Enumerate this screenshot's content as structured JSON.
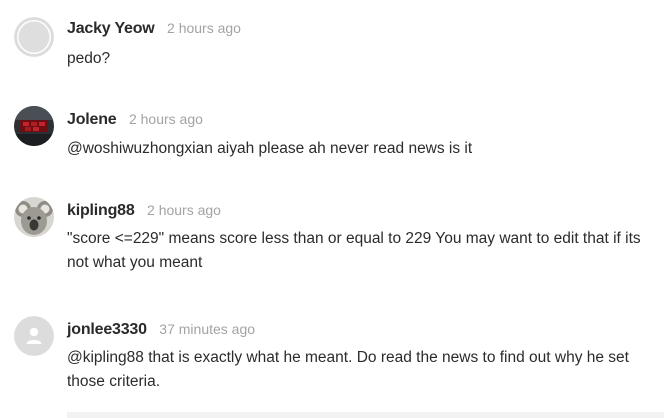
{
  "comments": [
    {
      "author": "Jacky Yeow",
      "time": "2 hours ago",
      "text": "pedo?",
      "avatar": "default-user-icon"
    },
    {
      "author": "Jolene",
      "time": "2 hours ago",
      "text": "@woshiwuzhongxian aiyah please ah never read news is it",
      "avatar": "photo-avatar"
    },
    {
      "author": "kipling88",
      "time": "2 hours ago",
      "text": "\"score <=229\" means score less than or equal to 229 You may want to edit that if its not what you meant",
      "avatar": "koala-photo-avatar"
    },
    {
      "author": "jonlee3330",
      "time": "37 minutes ago",
      "text": "@kipling88 that is exactly what he meant. Do read the news to find out why he set those criteria.",
      "avatar": "default-user-icon"
    }
  ],
  "colors": {
    "author": "#2a2a2a",
    "timestamp": "#a3a3a3",
    "default_avatar_bg": "#dcdcdc"
  }
}
